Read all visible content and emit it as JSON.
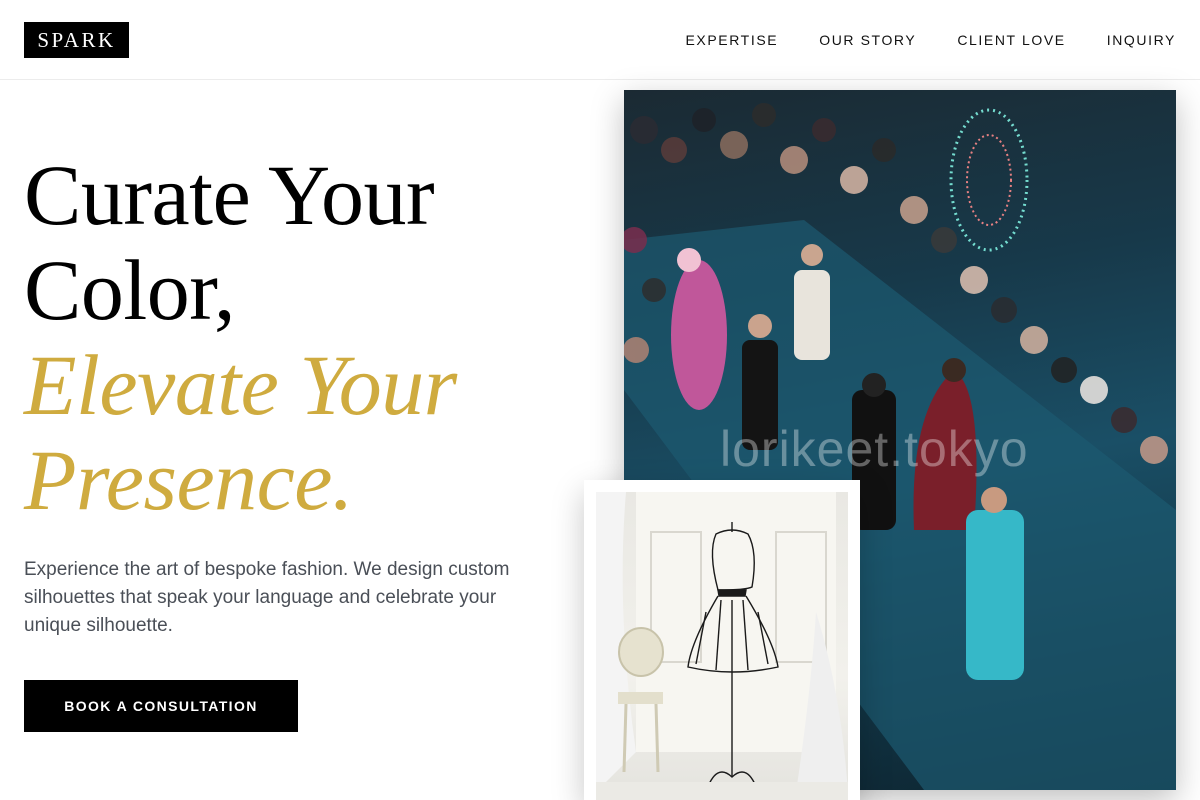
{
  "brand": {
    "logo_text": "SPARK"
  },
  "nav": {
    "items": [
      {
        "label": "EXPERTISE"
      },
      {
        "label": "OUR STORY"
      },
      {
        "label": "CLIENT LOVE"
      },
      {
        "label": "INQUIRY"
      }
    ]
  },
  "hero": {
    "headline_line1": "Curate Your",
    "headline_line2": "Color,",
    "headline_accent_line1": "Elevate Your",
    "headline_accent_line2": "Presence.",
    "description": "Experience the art of bespoke fashion. We design custom silhouettes that speak your language and celebrate your unique silhouette.",
    "cta_label": "BOOK A CONSULTATION"
  },
  "images": {
    "runway": {
      "icon": "runway-photo",
      "watermark": "lorikeet.tokyo"
    },
    "mannequin": {
      "icon": "dress-form-photo"
    }
  },
  "colors": {
    "accent": "#cfab3f",
    "text_muted": "#4a4f57",
    "button_bg": "#000000"
  }
}
